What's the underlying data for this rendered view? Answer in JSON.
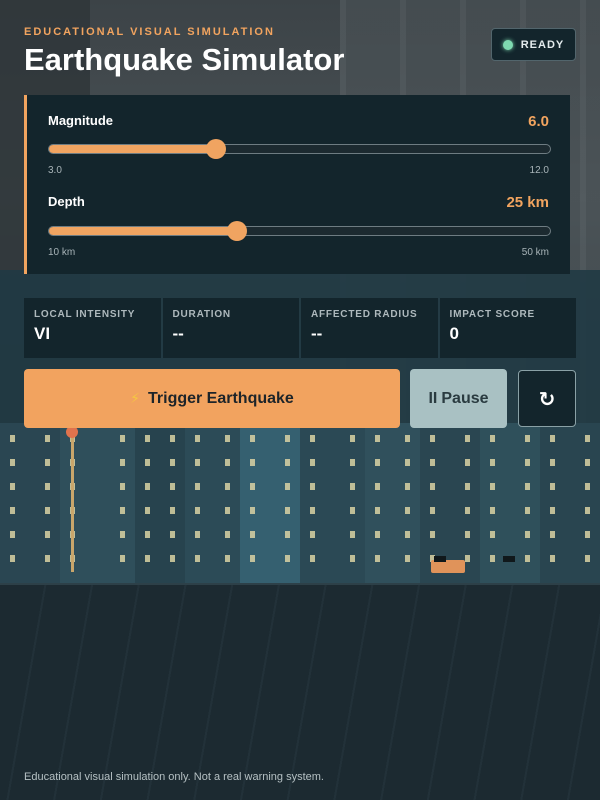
{
  "header": {
    "eyebrow": "EDUCATIONAL VISUAL SIMULATION",
    "title": "Earthquake Simulator",
    "status_label": "READY",
    "status_color": "#7fd9b0"
  },
  "controls": {
    "magnitude": {
      "label": "Magnitude",
      "value_text": "6.0",
      "value": 6.0,
      "min": 3.0,
      "max": 12.0,
      "min_label": "3.0",
      "max_label": "12.0"
    },
    "depth": {
      "label": "Depth",
      "value_text": "25 km",
      "value": 25,
      "min": 10,
      "max": 50,
      "min_label": "10 km",
      "max_label": "50 km"
    }
  },
  "stats": [
    {
      "label": "LOCAL INTENSITY",
      "value": "VI"
    },
    {
      "label": "DURATION",
      "value": "--"
    },
    {
      "label": "AFFECTED RADIUS",
      "value": "--"
    },
    {
      "label": "IMPACT SCORE",
      "value": "0"
    }
  ],
  "actions": {
    "trigger_icon": "⚡",
    "trigger_label": "Trigger Earthquake",
    "pause_icon": "II",
    "pause_label": "Pause",
    "reset_icon": "↻"
  },
  "footer": {
    "note": "Educational visual simulation only. Not a real warning system."
  },
  "colors": {
    "accent": "#f2a45f",
    "panel": "#13252c",
    "background": "#1b2e36"
  },
  "icons": [
    "status-dot-icon",
    "lightning-icon",
    "pause-icon",
    "reset-icon"
  ]
}
